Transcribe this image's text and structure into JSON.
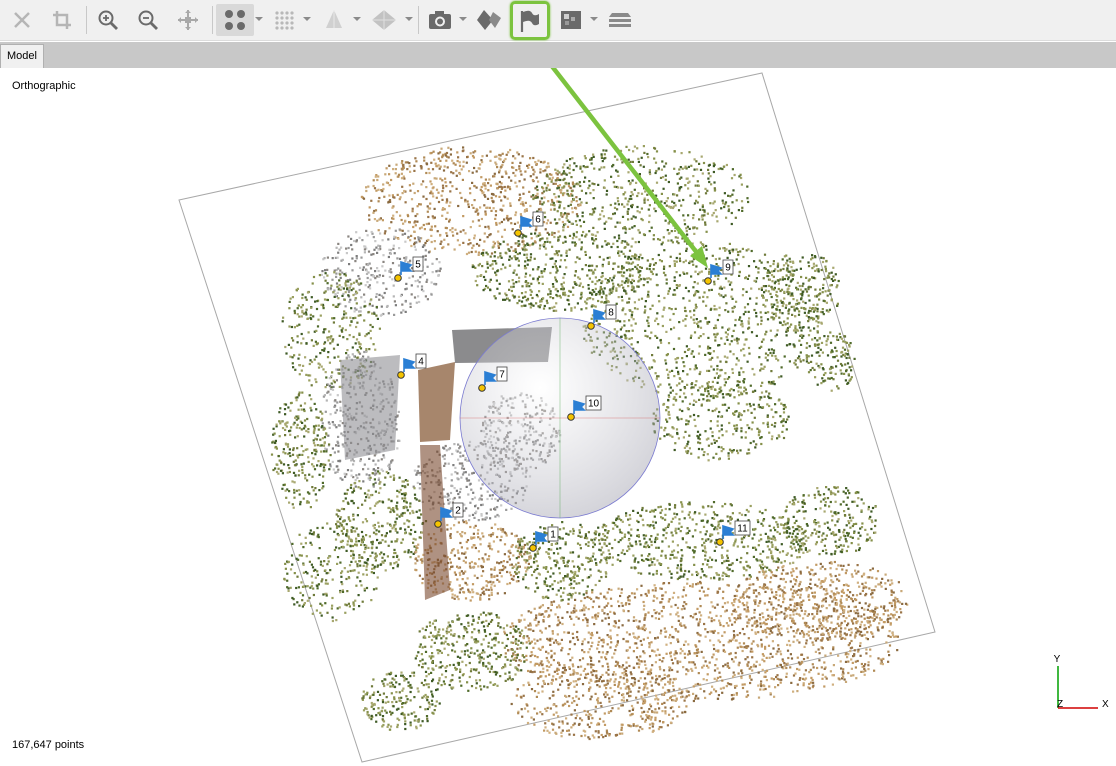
{
  "toolbar": {
    "buttons": [
      {
        "name": "close-icon",
        "enabled": false
      },
      {
        "name": "crop-icon",
        "enabled": false
      },
      {
        "name": "zoom-in-icon",
        "enabled": true
      },
      {
        "name": "zoom-out-icon",
        "enabled": true
      },
      {
        "name": "move-icon",
        "enabled": false
      },
      {
        "name": "point-cloud-icon",
        "enabled": true,
        "pressed": true
      },
      {
        "name": "dense-cloud-icon",
        "enabled": false
      },
      {
        "name": "tiled-model-icon",
        "enabled": false
      },
      {
        "name": "mesh-icon",
        "enabled": false
      },
      {
        "name": "camera-icon",
        "enabled": true
      },
      {
        "name": "shapes-icon",
        "enabled": true
      },
      {
        "name": "markers-flag-icon",
        "enabled": true,
        "highlighted": true
      },
      {
        "name": "dem-icon",
        "enabled": true
      },
      {
        "name": "layers-icon",
        "enabled": true
      }
    ],
    "highlight_color": "#7cc33f"
  },
  "tabs": [
    {
      "label": "Model",
      "active": true
    }
  ],
  "viewport": {
    "projection_label": "Orthographic",
    "points_label": "167,647 points",
    "axis": {
      "y": "Y",
      "z": "Z",
      "x": "X"
    }
  },
  "markers": [
    {
      "label": "1"
    },
    {
      "label": "2"
    },
    {
      "label": "4"
    },
    {
      "label": "5"
    },
    {
      "label": "6"
    },
    {
      "label": "7"
    },
    {
      "label": "8"
    },
    {
      "label": "9"
    },
    {
      "label": "10"
    },
    {
      "label": "11"
    }
  ],
  "colors": {
    "marker_flag": "#2b7fd4",
    "marker_dot": "#f5c400",
    "arrow": "#7cc33f",
    "axis_x": "#d00000",
    "axis_y": "#00a000"
  }
}
